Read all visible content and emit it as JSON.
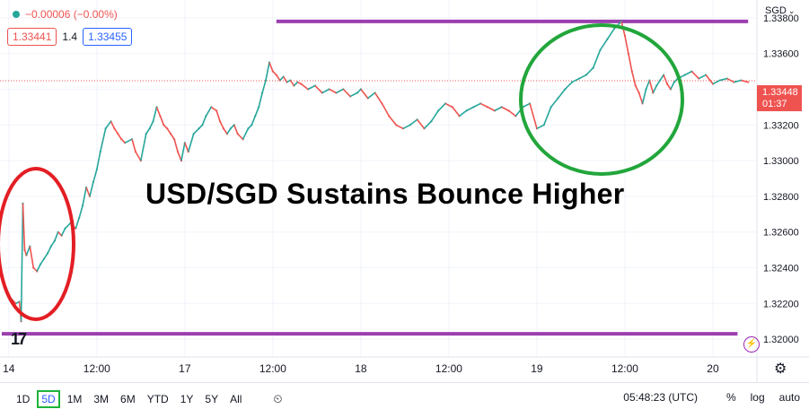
{
  "header": {
    "change": "−0.00006 (−0.00%)",
    "bid": "1.33441",
    "spread": "1.4",
    "ask": "1.33455",
    "currency": "SGD"
  },
  "price_tag": {
    "price": "1.33448",
    "countdown": "01:37"
  },
  "annotation": "USD/SGD Sustains Bounce Higher",
  "bottom": {
    "ranges": [
      "1D",
      "5D",
      "1M",
      "3M",
      "6M",
      "YTD",
      "1Y",
      "5Y",
      "All"
    ],
    "active_range": "5D",
    "clock": "05:48:23 (UTC)",
    "percent": "%",
    "log": "log",
    "auto": "auto"
  },
  "logo_text": "17",
  "icons": [
    "compare-icon",
    "settings-gear-icon",
    "lightning-icon",
    "chevron-down-icon"
  ],
  "chart_data": {
    "type": "line",
    "y_ticks": [
      "1.33800",
      "1.33600",
      "1.33400",
      "1.33200",
      "1.33000",
      "1.32800",
      "1.32600",
      "1.32400",
      "1.32200",
      "1.32000"
    ],
    "ylim": [
      1.319,
      1.339
    ],
    "x_tick_labels": [
      "14",
      "12:00",
      "17",
      "12:00",
      "18",
      "12:00",
      "19",
      "12:00",
      "20"
    ],
    "x_tick_pos_days": [
      0,
      0.5,
      1,
      1.5,
      2,
      2.5,
      3,
      3.5,
      4
    ],
    "xlim_days": [
      -0.05,
      4.25
    ],
    "series": [
      {
        "x": [
          0,
          0.02,
          0.04,
          0.06,
          0.07,
          0.08,
          0.09,
          0.1,
          0.12,
          0.14,
          0.16,
          0.18,
          0.2,
          0.22,
          0.24,
          0.26,
          0.28,
          0.3,
          0.32,
          0.35,
          0.38,
          0.4,
          0.42,
          0.44,
          0.46,
          0.48,
          0.5,
          0.52,
          0.55,
          0.58,
          0.6,
          0.62,
          0.64,
          0.66,
          0.7,
          0.72,
          0.75,
          0.78,
          0.8,
          0.82,
          0.84,
          0.86,
          0.88,
          0.9,
          0.92,
          0.94,
          0.96,
          0.98,
          1.0,
          1.02,
          1.05,
          1.08,
          1.1,
          1.12,
          1.15,
          1.18,
          1.2,
          1.22,
          1.24,
          1.26,
          1.28,
          1.3,
          1.33,
          1.36,
          1.38,
          1.4,
          1.42,
          1.44,
          1.46,
          1.48,
          1.5,
          1.52,
          1.54,
          1.56,
          1.58,
          1.6,
          1.62,
          1.64,
          1.66,
          1.7,
          1.74,
          1.78,
          1.82,
          1.86,
          1.9,
          1.94,
          1.98,
          2.0,
          2.04,
          2.08,
          2.12,
          2.16,
          2.2,
          2.24,
          2.28,
          2.32,
          2.36,
          2.4,
          2.44,
          2.48,
          2.52,
          2.56,
          2.6,
          2.64,
          2.68,
          2.72,
          2.76,
          2.8,
          2.84,
          2.88,
          2.92,
          2.96,
          3.0,
          3.04,
          3.08,
          3.12,
          3.16,
          3.2,
          3.24,
          3.28,
          3.32,
          3.36,
          3.4,
          3.44,
          3.48,
          3.5,
          3.52,
          3.54,
          3.56,
          3.58,
          3.6,
          3.62,
          3.64,
          3.66,
          3.68,
          3.7,
          3.72,
          3.74,
          3.76,
          3.78,
          3.8,
          3.84,
          3.88,
          3.92,
          3.96,
          4.0,
          4.04,
          4.08,
          4.12,
          4.16,
          4.2
        ],
        "y": [
          1.3222,
          1.3222,
          1.322,
          1.3221,
          1.321,
          1.3276,
          1.325,
          1.3247,
          1.3252,
          1.324,
          1.3238,
          1.3242,
          1.3245,
          1.3248,
          1.3252,
          1.3255,
          1.326,
          1.3258,
          1.3262,
          1.3265,
          1.3262,
          1.3268,
          1.3275,
          1.3285,
          1.328,
          1.3288,
          1.3295,
          1.3305,
          1.3318,
          1.3322,
          1.3318,
          1.3315,
          1.3312,
          1.331,
          1.3312,
          1.3305,
          1.33,
          1.3315,
          1.3318,
          1.3322,
          1.333,
          1.3325,
          1.332,
          1.3318,
          1.3315,
          1.3312,
          1.3305,
          1.33,
          1.331,
          1.3305,
          1.3315,
          1.3318,
          1.332,
          1.3325,
          1.333,
          1.3328,
          1.3322,
          1.3318,
          1.3315,
          1.3318,
          1.332,
          1.3315,
          1.3312,
          1.3318,
          1.332,
          1.3325,
          1.333,
          1.3338,
          1.3345,
          1.3355,
          1.335,
          1.3348,
          1.3345,
          1.3347,
          1.3344,
          1.3345,
          1.3342,
          1.3344,
          1.3343,
          1.334,
          1.3342,
          1.3338,
          1.334,
          1.3338,
          1.334,
          1.3336,
          1.3338,
          1.334,
          1.3335,
          1.3338,
          1.3332,
          1.3325,
          1.332,
          1.3318,
          1.332,
          1.3323,
          1.3318,
          1.3322,
          1.3328,
          1.3332,
          1.333,
          1.3325,
          1.3328,
          1.333,
          1.3332,
          1.333,
          1.3328,
          1.333,
          1.3328,
          1.3325,
          1.333,
          1.3332,
          1.3318,
          1.332,
          1.333,
          1.3335,
          1.334,
          1.3344,
          1.3346,
          1.3348,
          1.3352,
          1.3362,
          1.3368,
          1.3374,
          1.3378,
          1.337,
          1.336,
          1.335,
          1.3342,
          1.3338,
          1.3332,
          1.334,
          1.3345,
          1.3338,
          1.3342,
          1.3345,
          1.3348,
          1.3343,
          1.334,
          1.3344,
          1.3346,
          1.3348,
          1.335,
          1.3346,
          1.3348,
          1.3343,
          1.3345,
          1.3346,
          1.3344,
          1.3345,
          1.3344
        ]
      }
    ],
    "levels": [
      {
        "name": "resistance",
        "y": 1.3378,
        "x": [
          1.52,
          4.2
        ],
        "color": "#9c3fb0"
      },
      {
        "name": "support",
        "y": 1.3203,
        "x": [
          -0.04,
          4.14
        ],
        "color": "#9c3fb0"
      }
    ],
    "current_price_line": 1.33448,
    "highlights": [
      {
        "name": "red-ellipse",
        "color": "#e31e24"
      },
      {
        "name": "green-ellipse",
        "color": "#22a63b"
      }
    ]
  }
}
